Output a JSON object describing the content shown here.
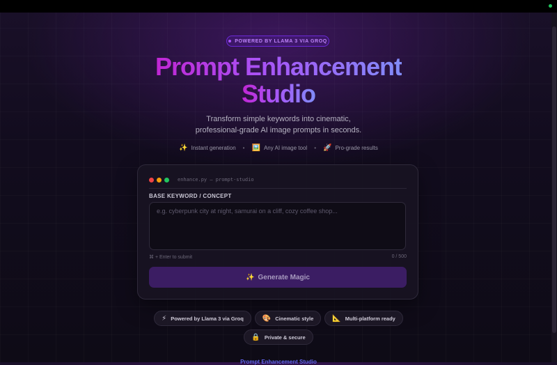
{
  "badge": {
    "label": "POWERED BY LLAMA 3 VIA GROQ"
  },
  "hero": {
    "title_line1": "Prompt Enhancement",
    "title_line2": "Studio",
    "subtitle": "Transform simple keywords into cinematic, professional-grade AI image prompts in seconds."
  },
  "features": [
    {
      "icon": "✨",
      "label": "Instant generation"
    },
    {
      "icon": "🖼️",
      "label": "Any AI image tool"
    },
    {
      "icon": "🚀",
      "label": "Pro-grade results"
    }
  ],
  "features_separator": "•",
  "editor": {
    "filename": "enhance.py — prompt-studio",
    "field_label": "BASE KEYWORD / CONCEPT",
    "placeholder": "e.g. cyberpunk city at night, samurai on a cliff, cozy coffee shop...",
    "value": "",
    "hint": "⌘ + Enter to submit",
    "counter": "0 / 500",
    "button_icon": "✨",
    "button_label": "Generate Magic"
  },
  "chips": [
    {
      "icon": "⚡",
      "label": "Powered by Llama 3 via Groq"
    },
    {
      "icon": "🎨",
      "label": "Cinematic style"
    },
    {
      "icon": "📐",
      "label": "Multi-platform ready"
    },
    {
      "icon": "🔒",
      "label": "Private & secure"
    }
  ],
  "footer": {
    "link_text": "Prompt Enhancement Studio"
  },
  "colors": {
    "accent": "#a855f7",
    "accent_deep": "#3b1d63",
    "background": "#120c1e"
  }
}
